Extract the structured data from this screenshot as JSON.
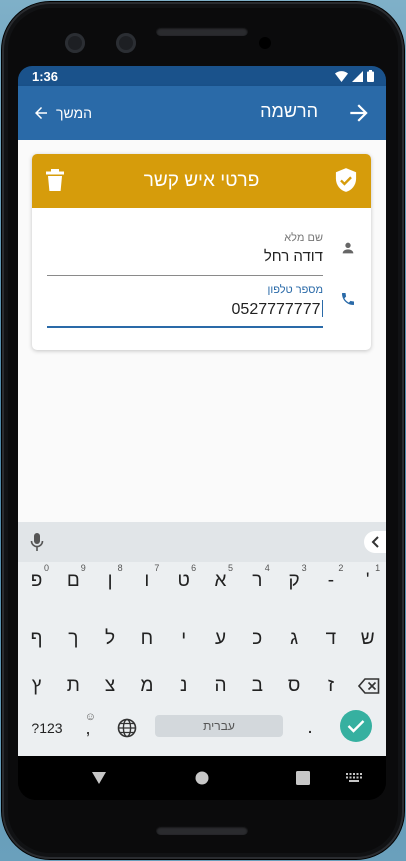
{
  "status_bar": {
    "time": "1:36"
  },
  "app_bar": {
    "title": "הרשמה",
    "back_label": "המשך"
  },
  "card": {
    "title": "פרטי איש קשר",
    "name_field": {
      "label": "שם מלא",
      "value": "דודה רחל"
    },
    "phone_field": {
      "label": "מספר טלפון",
      "value": "0527777777"
    }
  },
  "fab": {
    "label": "+"
  },
  "keyboard": {
    "rows": [
      [
        {
          "key": "פ",
          "hint": "0"
        },
        {
          "key": "ם",
          "hint": "9"
        },
        {
          "key": "ן",
          "hint": "8"
        },
        {
          "key": "ו",
          "hint": "7"
        },
        {
          "key": "ט",
          "hint": "6"
        },
        {
          "key": "א",
          "hint": "5"
        },
        {
          "key": "ר",
          "hint": "4"
        },
        {
          "key": "ק",
          "hint": "3"
        },
        {
          "key": "-",
          "hint": "2"
        },
        {
          "key": "'",
          "hint": "1"
        }
      ],
      [
        {
          "key": "ף"
        },
        {
          "key": "ך"
        },
        {
          "key": "ל"
        },
        {
          "key": "ח"
        },
        {
          "key": "י"
        },
        {
          "key": "ע"
        },
        {
          "key": "כ"
        },
        {
          "key": "ג"
        },
        {
          "key": "ד"
        },
        {
          "key": "ש"
        }
      ],
      [
        {
          "key": "ץ"
        },
        {
          "key": "ת"
        },
        {
          "key": "צ"
        },
        {
          "key": "מ"
        },
        {
          "key": "נ"
        },
        {
          "key": "ה"
        },
        {
          "key": "ב"
        },
        {
          "key": "ס"
        },
        {
          "key": "ז"
        }
      ]
    ],
    "symbols_label": "?123",
    "comma_label": ",",
    "space_label": "עברית",
    "period_label": "."
  },
  "colors": {
    "primary": "#2a6aa8",
    "status_bar": "#1a528b",
    "card_header": "#d69c0b",
    "enter_key": "#36b0a0"
  },
  "icons": {
    "back": "arrow-left-icon",
    "forward": "arrow-right-icon",
    "delete": "trash-icon",
    "verified": "shield-check-icon",
    "name": "person-icon",
    "phone": "phone-icon",
    "mic": "mic-icon",
    "emoji": "emoji-icon",
    "language": "globe-icon",
    "backspace": "backspace-icon",
    "done": "check-icon"
  }
}
